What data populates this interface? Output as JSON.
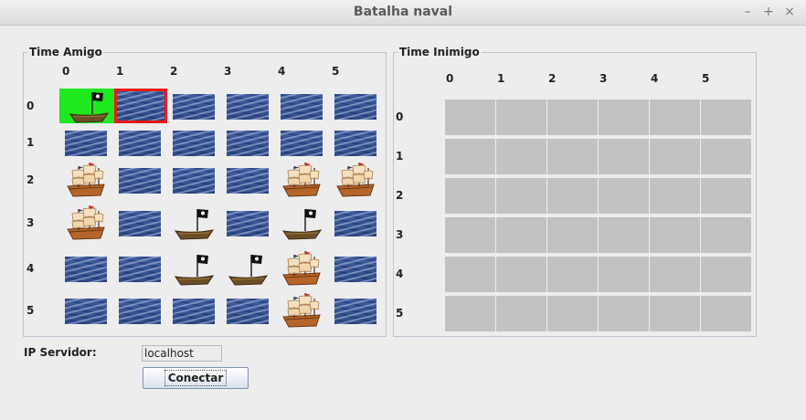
{
  "window": {
    "title": "Batalha naval",
    "controls": [
      "–",
      "+",
      "×"
    ]
  },
  "friendly": {
    "legend": "Time Amigo",
    "col_labels": [
      "0",
      "1",
      "2",
      "3",
      "4",
      "5"
    ],
    "row_labels": [
      "0",
      "1",
      "2",
      "3",
      "4",
      "5"
    ],
    "grid": [
      [
        "boat-hit",
        "water-selected",
        "water",
        "water",
        "water",
        "water"
      ],
      [
        "water",
        "water",
        "water",
        "water",
        "water",
        "water"
      ],
      [
        "galleon",
        "water",
        "water",
        "water",
        "galleon",
        "galleon"
      ],
      [
        "galleon",
        "water",
        "boat",
        "water",
        "boat",
        "water"
      ],
      [
        "water",
        "water",
        "boat",
        "boat",
        "galleon",
        "water"
      ],
      [
        "water",
        "water",
        "water",
        "water",
        "galleon",
        "water"
      ]
    ],
    "colors": {
      "hit_bg": "#1ee81e",
      "selected_border": "#f01818"
    }
  },
  "enemy": {
    "legend": "Time Inimigo",
    "col_labels": [
      "0",
      "1",
      "2",
      "3",
      "4",
      "5"
    ],
    "row_labels": [
      "0",
      "1",
      "2",
      "3",
      "4",
      "5"
    ],
    "tile_color": "#c2c2c2"
  },
  "server": {
    "label": "IP Servidor:",
    "value": "localhost",
    "connect_label": "Conectar"
  }
}
